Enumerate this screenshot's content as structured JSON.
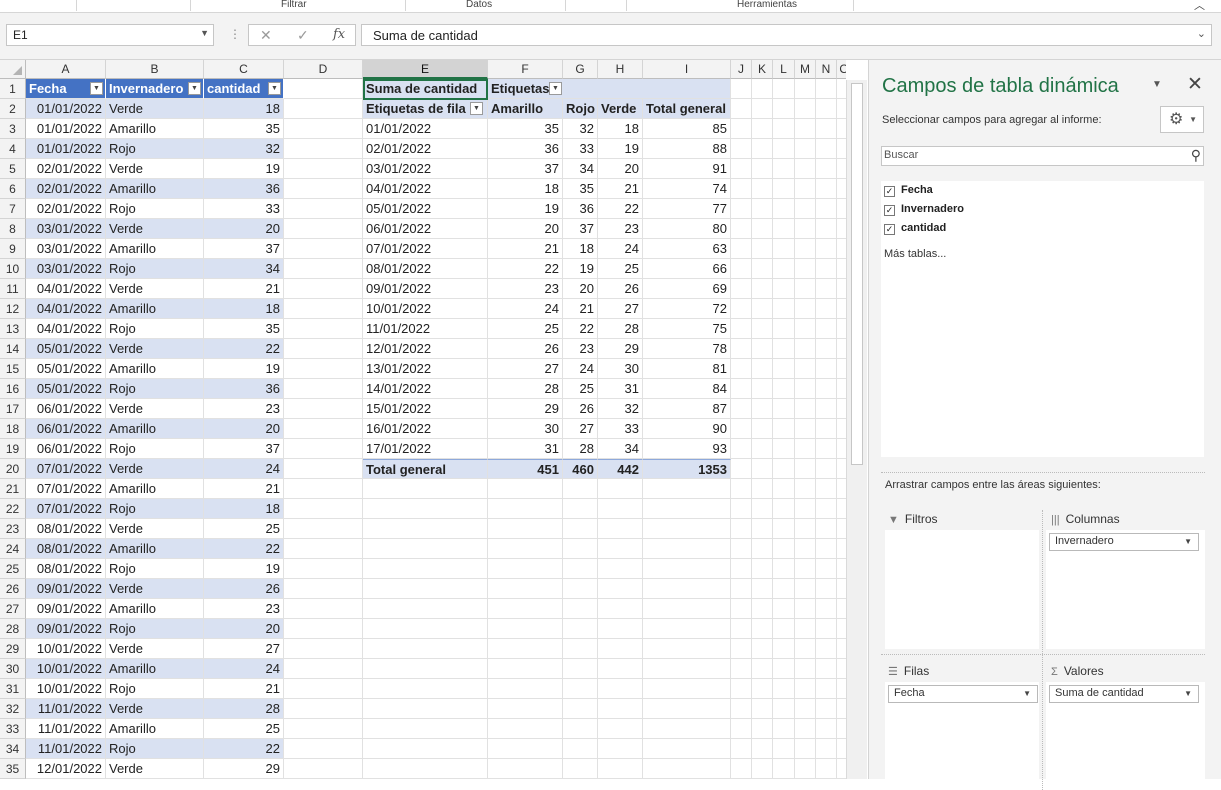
{
  "ribbon": {
    "groups": [
      "Filtrar",
      "Datos",
      "Herramientas"
    ],
    "collapse_icon": "chevron-up-icon"
  },
  "formula_bar": {
    "name_box": "E1",
    "formula": "Suma de cantidad",
    "cancel": "✕",
    "enter": "✓",
    "fx": "fx"
  },
  "columns": [
    "A",
    "B",
    "C",
    "D",
    "E",
    "F",
    "G",
    "H",
    "I",
    "J",
    "K",
    "L",
    "M",
    "N",
    "O"
  ],
  "source_table": {
    "headers": [
      "Fecha",
      "Invernadero",
      "cantidad"
    ],
    "rows": [
      [
        "01/01/2022",
        "Verde",
        "18"
      ],
      [
        "01/01/2022",
        "Amarillo",
        "35"
      ],
      [
        "01/01/2022",
        "Rojo",
        "32"
      ],
      [
        "02/01/2022",
        "Verde",
        "19"
      ],
      [
        "02/01/2022",
        "Amarillo",
        "36"
      ],
      [
        "02/01/2022",
        "Rojo",
        "33"
      ],
      [
        "03/01/2022",
        "Verde",
        "20"
      ],
      [
        "03/01/2022",
        "Amarillo",
        "37"
      ],
      [
        "03/01/2022",
        "Rojo",
        "34"
      ],
      [
        "04/01/2022",
        "Verde",
        "21"
      ],
      [
        "04/01/2022",
        "Amarillo",
        "18"
      ],
      [
        "04/01/2022",
        "Rojo",
        "35"
      ],
      [
        "05/01/2022",
        "Verde",
        "22"
      ],
      [
        "05/01/2022",
        "Amarillo",
        "19"
      ],
      [
        "05/01/2022",
        "Rojo",
        "36"
      ],
      [
        "06/01/2022",
        "Verde",
        "23"
      ],
      [
        "06/01/2022",
        "Amarillo",
        "20"
      ],
      [
        "06/01/2022",
        "Rojo",
        "37"
      ],
      [
        "07/01/2022",
        "Verde",
        "24"
      ],
      [
        "07/01/2022",
        "Amarillo",
        "21"
      ],
      [
        "07/01/2022",
        "Rojo",
        "18"
      ],
      [
        "08/01/2022",
        "Verde",
        "25"
      ],
      [
        "08/01/2022",
        "Amarillo",
        "22"
      ],
      [
        "08/01/2022",
        "Rojo",
        "19"
      ],
      [
        "09/01/2022",
        "Verde",
        "26"
      ],
      [
        "09/01/2022",
        "Amarillo",
        "23"
      ],
      [
        "09/01/2022",
        "Rojo",
        "20"
      ],
      [
        "10/01/2022",
        "Verde",
        "27"
      ],
      [
        "10/01/2022",
        "Amarillo",
        "24"
      ],
      [
        "10/01/2022",
        "Rojo",
        "21"
      ],
      [
        "11/01/2022",
        "Verde",
        "28"
      ],
      [
        "11/01/2022",
        "Amarillo",
        "25"
      ],
      [
        "11/01/2022",
        "Rojo",
        "22"
      ],
      [
        "12/01/2022",
        "Verde",
        "29"
      ]
    ]
  },
  "pivot": {
    "values_label": "Suma de cantidad",
    "col_labels": "Etiquetas",
    "row_labels": "Etiquetas de fila",
    "col_headers": [
      "Amarillo",
      "Rojo",
      "Verde",
      "Total general"
    ],
    "rows": [
      [
        "01/01/2022",
        "35",
        "32",
        "18",
        "85"
      ],
      [
        "02/01/2022",
        "36",
        "33",
        "19",
        "88"
      ],
      [
        "03/01/2022",
        "37",
        "34",
        "20",
        "91"
      ],
      [
        "04/01/2022",
        "18",
        "35",
        "21",
        "74"
      ],
      [
        "05/01/2022",
        "19",
        "36",
        "22",
        "77"
      ],
      [
        "06/01/2022",
        "20",
        "37",
        "23",
        "80"
      ],
      [
        "07/01/2022",
        "21",
        "18",
        "24",
        "63"
      ],
      [
        "08/01/2022",
        "22",
        "19",
        "25",
        "66"
      ],
      [
        "09/01/2022",
        "23",
        "20",
        "26",
        "69"
      ],
      [
        "10/01/2022",
        "24",
        "21",
        "27",
        "72"
      ],
      [
        "11/01/2022",
        "25",
        "22",
        "28",
        "75"
      ],
      [
        "12/01/2022",
        "26",
        "23",
        "29",
        "78"
      ],
      [
        "13/01/2022",
        "27",
        "24",
        "30",
        "81"
      ],
      [
        "14/01/2022",
        "28",
        "25",
        "31",
        "84"
      ],
      [
        "15/01/2022",
        "29",
        "26",
        "32",
        "87"
      ],
      [
        "16/01/2022",
        "30",
        "27",
        "33",
        "90"
      ],
      [
        "17/01/2022",
        "31",
        "28",
        "34",
        "93"
      ]
    ],
    "total_row": [
      "Total general",
      "451",
      "460",
      "442",
      "1353"
    ]
  },
  "pane": {
    "title": "Campos de tabla dinámica",
    "subtitle": "Seleccionar campos para agregar al informe:",
    "search_placeholder": "Buscar",
    "fields": [
      "Fecha",
      "Invernadero",
      "cantidad"
    ],
    "more_tables": "Más tablas...",
    "drag_text": "Arrastrar campos entre las áreas siguientes:",
    "areas": {
      "filters": "Filtros",
      "columns": "Columnas",
      "rows": "Filas",
      "values": "Valores"
    },
    "columns_field": "Invernadero",
    "rows_field": "Fecha",
    "values_field": "Suma de cantidad"
  },
  "colors": {
    "accent": "#217346",
    "table_header": "#4472c4",
    "band": "#d9e1f2"
  }
}
